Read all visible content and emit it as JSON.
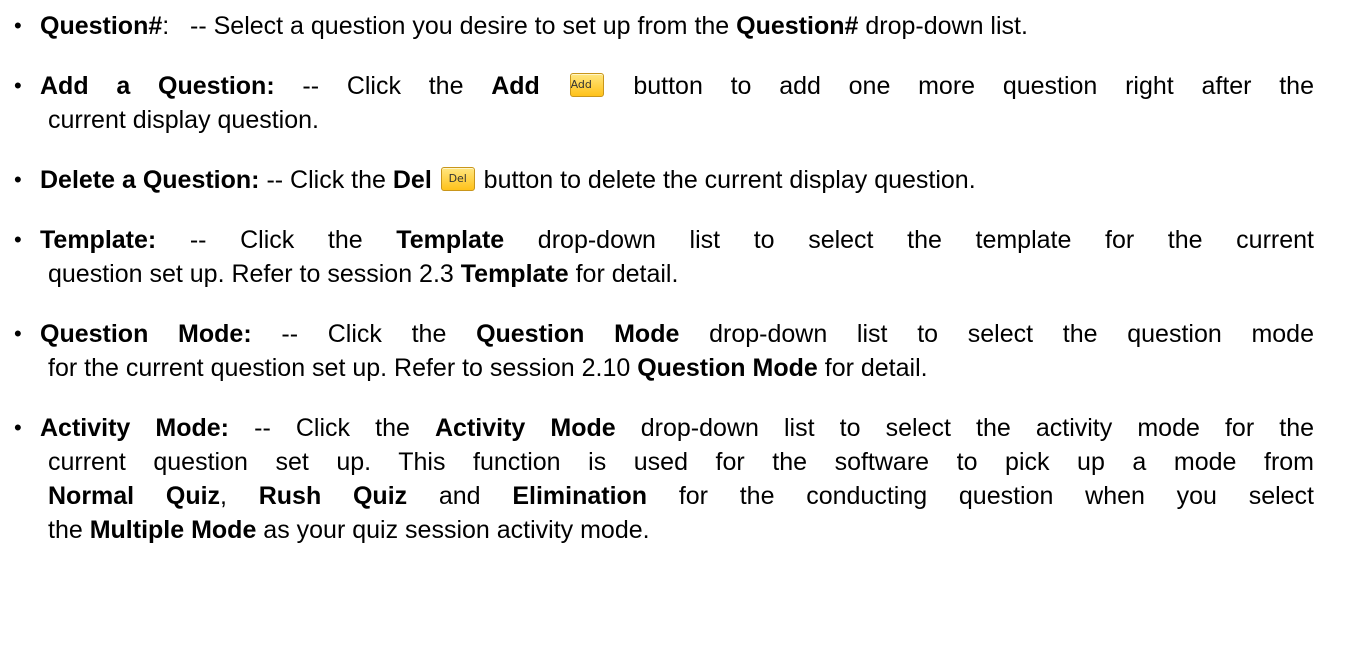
{
  "items": [
    {
      "term": "Question#",
      "lines": [
        {
          "a": ":   -- Select a question you desire to set up from the ",
          "b": "Question#",
          "c": " drop-down list."
        }
      ]
    },
    {
      "term": "Add a Question:",
      "l1a": " -- Click the ",
      "l1b": "Add",
      "button": "Add",
      "l1c": " button to add one more question right after the",
      "l2": "current display question."
    },
    {
      "term": "Delete a Question:",
      "l1a": " -- Click the ",
      "l1b": "Del",
      "button": "Del",
      "l1c": " button to delete the current display question."
    },
    {
      "term": "Template:",
      "l1a": " -- Click the ",
      "l1b": "Template",
      "l1c": " drop-down list to select the template for the current",
      "l2a": "question set up. Refer to session 2.3 ",
      "l2b": "Template",
      "l2c": " for detail."
    },
    {
      "term": "Question Mode:",
      "l1a": " -- Click the ",
      "l1b": "Question Mode",
      "l1c": " drop-down list to select the question mode",
      "l2a": "for the current question set up. Refer to session 2.10 ",
      "l2b": "Question Mode",
      "l2c": " for detail."
    },
    {
      "term": "Activity Mode:",
      "l1a": " -- Click the ",
      "l1b": "Activity Mode",
      "l1c": " drop-down list to select the activity mode for the",
      "l2": "current question set up. This function is used for the software to pick up a mode from",
      "l3a": "Normal Quiz",
      "l3b": ", ",
      "l3c": "Rush Quiz",
      "l3d": " and ",
      "l3e": "Elimination",
      "l3f": " for the conducting question when you select",
      "l4a": "the ",
      "l4b": "Multiple Mode",
      "l4c": " as your quiz session activity mode."
    }
  ]
}
